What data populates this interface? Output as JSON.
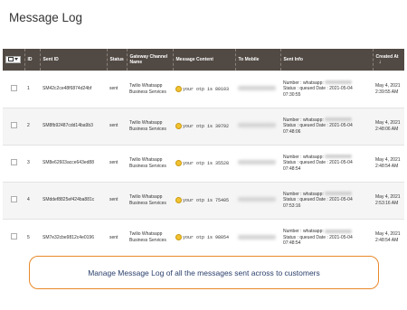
{
  "page": {
    "title": "Message Log"
  },
  "grid": {
    "headers": {
      "id": "ID",
      "sent_id": "Sent ID",
      "status": "Status",
      "gateway": "Gateway Channel Name",
      "content": "Message Content",
      "mobile": "To Mobile",
      "info": "Sent Info",
      "created": "Created At"
    },
    "rows": [
      {
        "id": "1",
        "sent_id": "SM42c2ce48f6874d24bf",
        "status": "sent",
        "gateway": "Twilio Whatsapp Business Services",
        "content": "your otp is 80103",
        "info_number": "Number : whatsapp:",
        "info_status": "Status : queued Date : 2021-05-04",
        "info_time": "07:30:55",
        "created_date": "May 4, 2021",
        "created_time": "2:39:55 AM"
      },
      {
        "id": "2",
        "sent_id": "SM8fb92487cdd14ba9b3",
        "status": "sent",
        "gateway": "Twilio Whatsapp Business Services",
        "content": "your otp is 39792",
        "info_number": "Number : whatsapp:",
        "info_status": "Status : queued Date : 2021-05-04",
        "info_time": "07:48:06",
        "created_date": "May 4, 2021",
        "created_time": "2:48:06 AM"
      },
      {
        "id": "3",
        "sent_id": "SM8e62603acce643ed88",
        "status": "sent",
        "gateway": "Twilio Whatsapp Business Services",
        "content": "your otp is 35528",
        "info_number": "Number : whatsapp:",
        "info_status": "Status : queued Date : 2021-05-04",
        "info_time": "07:48:54",
        "created_date": "May 4, 2021",
        "created_time": "2:48:54 AM"
      },
      {
        "id": "4",
        "sent_id": "SMddef8825ef424ba881c",
        "status": "sent",
        "gateway": "Twilio Whatsapp Business Services",
        "content": "your otp is 75405",
        "info_number": "Number : whatsapp:",
        "info_status": "Status : queued Date : 2021-05-04",
        "info_time": "07:53:16",
        "created_date": "May 4, 2021",
        "created_time": "2:53:16 AM"
      },
      {
        "id": "5",
        "sent_id": "SM7e32cbe9812c4e0196",
        "status": "sent",
        "gateway": "Twilio Whatsapp Business Services",
        "content": "your otp is 98054",
        "info_number": "Number : whatsapp:",
        "info_status": "Status : queued Date : 2021-05-04",
        "info_time": "07:48:54",
        "created_date": "May 4, 2021",
        "created_time": "2:48:54 AM"
      }
    ]
  },
  "caption": {
    "text": "Manage Message Log of all the messages sent across to customers"
  },
  "colors": {
    "header_bg": "#514943",
    "caption_border": "#e8892a",
    "caption_text": "#2a3f6b"
  },
  "icons": {
    "sort": "sort-down-arrow-icon",
    "content": "smiley-emoji-icon"
  }
}
